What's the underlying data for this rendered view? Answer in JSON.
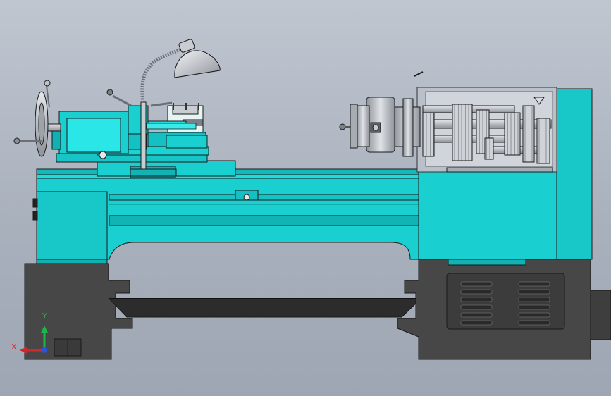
{
  "viewport": {
    "background_top": "#bfc6d0",
    "background_bottom": "#9ea6b3"
  },
  "model": {
    "subject": "lathe-assembly",
    "body_color": "#19cfcf",
    "body_shadow_color": "#10a9ab",
    "base_color": "#474747",
    "metal_color": "#c9ccd1",
    "outline_color": "#1a1a1a"
  },
  "triad": {
    "x_label": "X",
    "y_label": "Y",
    "x_color": "#d3272a",
    "y_color": "#1fb34a",
    "z_color": "#2a55d9"
  }
}
